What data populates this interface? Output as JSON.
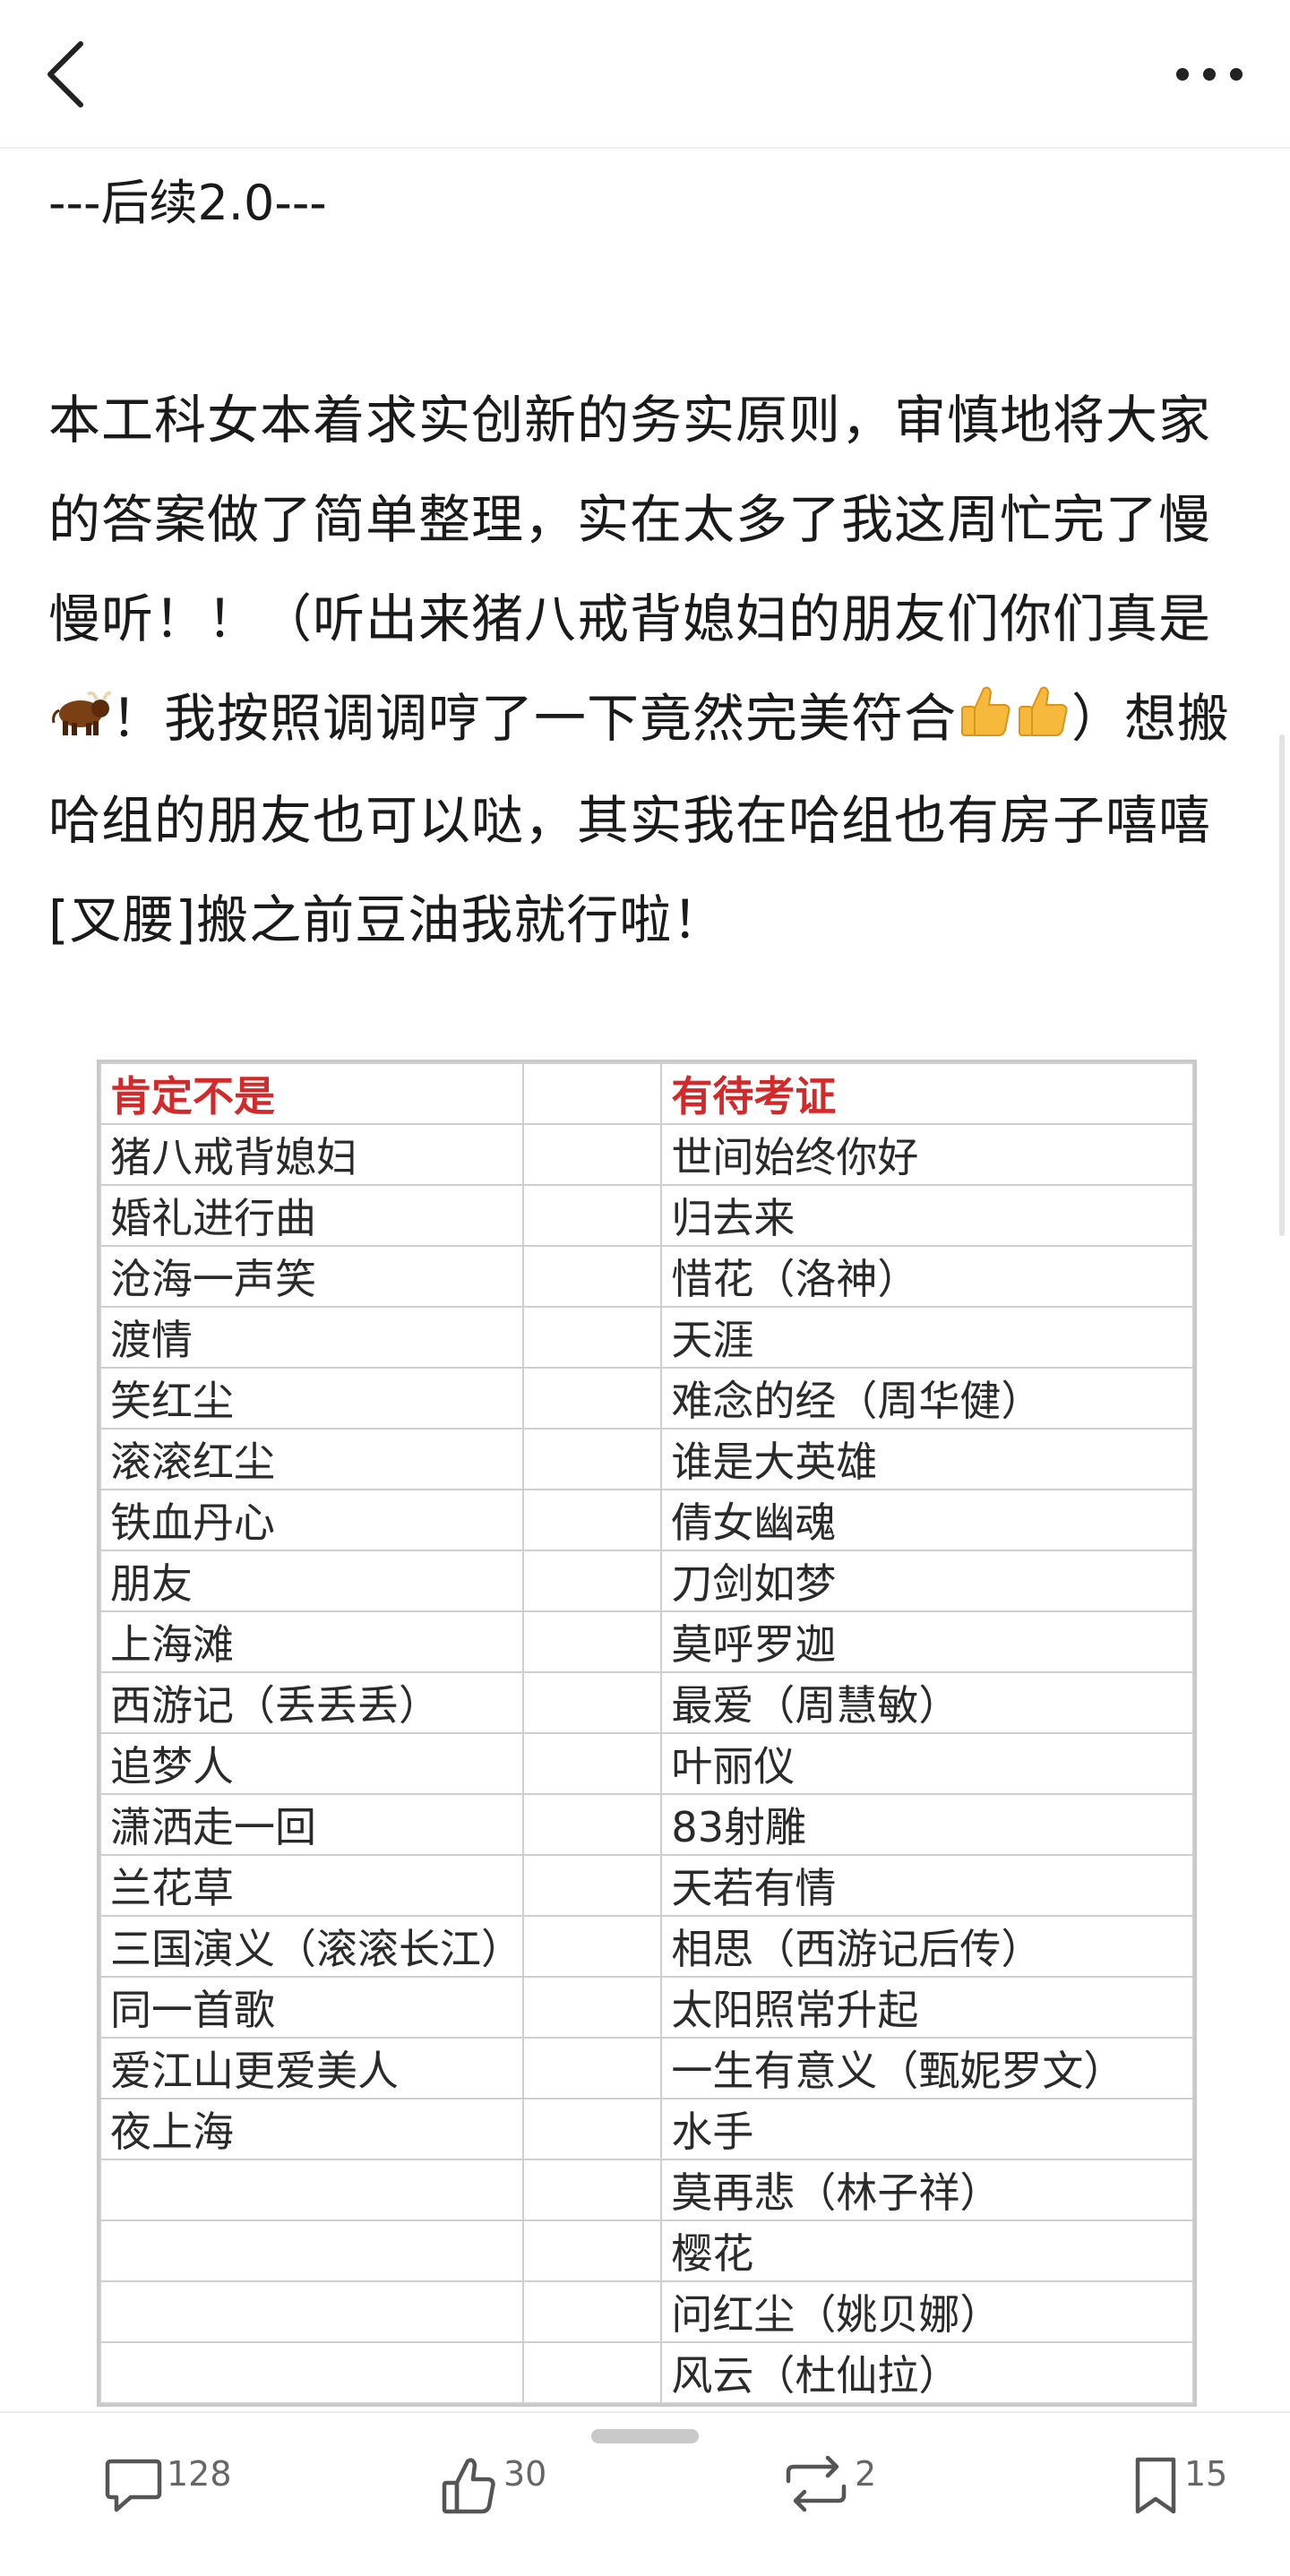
{
  "nav": {
    "back_icon": "chevron-left-icon",
    "more_icon": "more-horizontal-icon"
  },
  "post": {
    "subtitle": "---后续2.0---",
    "body_part1": "本工科女本着求实创新的务实原则，审慎地将大家的答案做了简单整理，实在太多了我这周忙完了慢慢听！！（听出来猪八戒背媳妇的朋友们你们真是",
    "body_part2": "！我按照调调哼了一下竟然完美符合",
    "body_part3": "）想搬哈组的朋友也可以哒，其实我在哈组也有房子嘻嘻[叉腰]搬之前豆油我就行啦！",
    "emoji_ox": "ox-emoji",
    "emoji_thumb": "thumbs-up-emoji"
  },
  "table": {
    "headers": [
      "肯定不是",
      "",
      "有待考证"
    ],
    "rows": [
      [
        "猪八戒背媳妇",
        "世间始终你好"
      ],
      [
        "婚礼进行曲",
        "归去来"
      ],
      [
        "沧海一声笑",
        "惜花（洛神）"
      ],
      [
        "渡情",
        "天涯"
      ],
      [
        "笑红尘",
        "难念的经（周华健）"
      ],
      [
        "滚滚红尘",
        "谁是大英雄"
      ],
      [
        "铁血丹心",
        "倩女幽魂"
      ],
      [
        "朋友",
        "刀剑如梦"
      ],
      [
        "上海滩",
        "莫呼罗迦"
      ],
      [
        "西游记（丢丢丢）",
        "最爱（周慧敏）"
      ],
      [
        "追梦人",
        "叶丽仪"
      ],
      [
        "潇洒走一回",
        "83射雕"
      ],
      [
        "兰花草",
        "天若有情"
      ],
      [
        "三国演义（滚滚长江）",
        "相思（西游记后传）"
      ],
      [
        "同一首歌",
        "太阳照常升起"
      ],
      [
        "爱江山更爱美人",
        "一生有意义（甄妮罗文）"
      ],
      [
        "夜上海",
        "水手"
      ],
      [
        "",
        "莫再悲（林子祥）"
      ],
      [
        "",
        "樱花"
      ],
      [
        "",
        "问红尘（姚贝娜）"
      ],
      [
        "",
        "风云（杜仙拉）"
      ]
    ],
    "header_color": "#d22a2a"
  },
  "actions": {
    "comment": {
      "icon": "comment-icon",
      "count": "128"
    },
    "like": {
      "icon": "thumbs-up-icon",
      "count": "30"
    },
    "repost": {
      "icon": "repost-icon",
      "count": "2"
    },
    "bookmark": {
      "icon": "bookmark-icon",
      "count": "15"
    }
  }
}
